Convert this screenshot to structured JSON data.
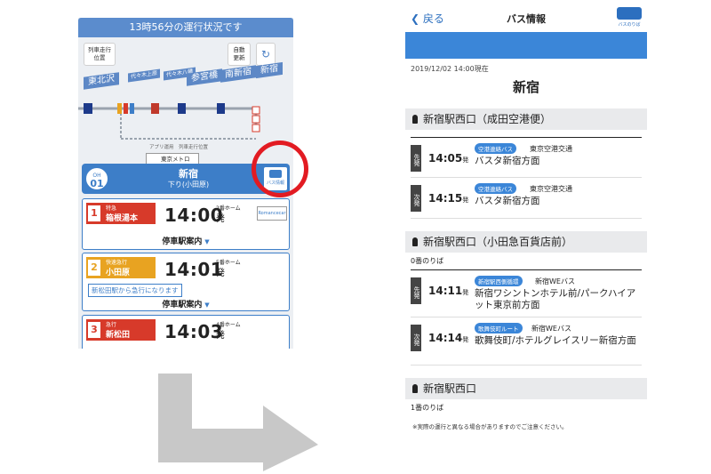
{
  "left_screen": {
    "status_text": "13時56分の運行状況です",
    "train_position_button": "列車走行\n位置",
    "auto_update_button": "自動\n更新",
    "refresh_icon": "refresh-icon",
    "map": {
      "stations": [
        "東北沢",
        "代々木上原",
        "代々木八幡",
        "参宮橋",
        "南新宿",
        "新宿"
      ],
      "app_note": "アプリ運用　列車走行位置",
      "metro_label": "東京メトロ\n千代田線"
    },
    "station": {
      "badge_top": "OH",
      "badge_num": "01",
      "name": "新宿",
      "direction": "下り(小田原)",
      "bus_button_label": "バス情報"
    },
    "trains": [
      {
        "num": "1",
        "kind": "特急",
        "dest": "箱根湯本",
        "yuki": "行",
        "time": "14:00",
        "platform": "2番ホーム",
        "hatsu": "発",
        "stops_label": "停車駅案内",
        "badge": "Romancecar",
        "color": "#d73a2a"
      },
      {
        "num": "2",
        "kind": "快速急行",
        "dest": "小田原",
        "yuki": "行",
        "time": "14:01",
        "platform": "5番ホーム",
        "hatsu": "発",
        "note": "新松田駅から急行になります",
        "stops_label": "停車駅案内",
        "color": "#e8a321"
      },
      {
        "num": "3",
        "kind": "急行",
        "dest": "新松田",
        "yuki": "行",
        "time": "14:03",
        "platform": "4番ホーム",
        "hatsu": "発",
        "color": "#d73a2a"
      }
    ]
  },
  "right_screen": {
    "back_label": "戻る",
    "title": "バス情報",
    "bus_stop_label": "バスのりば",
    "timestamp": "2019/12/02 14:00現在",
    "station": "新宿",
    "sections": [
      {
        "title": "新宿駅西口（成田空港便）",
        "noriba": "",
        "rows": [
          {
            "order": "先発",
            "time": "14:05",
            "suffix": "発",
            "route": "空港連絡バス",
            "operator": "東京空港交通",
            "dest": "バスタ新宿方面"
          },
          {
            "order": "次発",
            "time": "14:15",
            "suffix": "発",
            "route": "空港連絡バス",
            "operator": "東京空港交通",
            "dest": "バスタ新宿方面"
          }
        ]
      },
      {
        "title": "新宿駅西口（小田急百貨店前）",
        "noriba": "0番のりば",
        "rows": [
          {
            "order": "先発",
            "time": "14:11",
            "suffix": "発",
            "route": "新宿駅西側循環",
            "operator": "新宿WEバス",
            "dest": "新宿ワシントンホテル前/パークハイアット東京前方面"
          },
          {
            "order": "次発",
            "time": "14:14",
            "suffix": "発",
            "route": "歌舞伎町ルート",
            "operator": "新宿WEバス",
            "dest": "歌舞伎町/ホテルグレイスリー新宿方面"
          }
        ]
      },
      {
        "title": "新宿駅西口",
        "noriba": "1番のりば",
        "rows": []
      }
    ],
    "footer_note": "※実際の運行と異なる場合がありますのでご注意ください。"
  },
  "colors": {
    "accent": "#3b86d8",
    "highlight": "#e21b22",
    "arrow": "#c8c8c8"
  }
}
